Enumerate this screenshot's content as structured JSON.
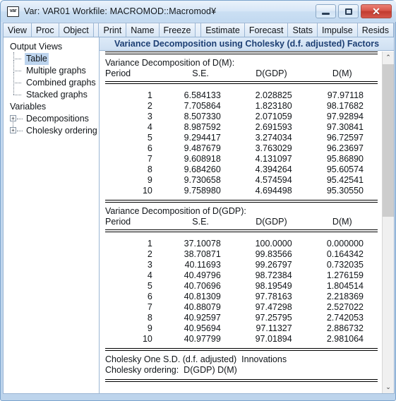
{
  "window": {
    "icon_label": "var",
    "title": "Var: VAR01   Workfile: MACROMOD::Macromod¥",
    "minimize_label": "—",
    "maximize_label": "□",
    "close_label": "✕"
  },
  "toolbar": {
    "buttons": [
      "View",
      "Proc",
      "Object",
      "Print",
      "Name",
      "Freeze",
      "Estimate",
      "Forecast",
      "Stats",
      "Impulse",
      "Resids"
    ]
  },
  "sidebar": {
    "groups": [
      {
        "title": "Output Views",
        "items": [
          {
            "label": "Table",
            "selected": true,
            "expandable": false
          },
          {
            "label": "Multiple graphs",
            "selected": false,
            "expandable": false
          },
          {
            "label": "Combined graphs",
            "selected": false,
            "expandable": false
          },
          {
            "label": "Stacked graphs",
            "selected": false,
            "expandable": false
          }
        ]
      },
      {
        "title": "Variables",
        "items": [
          {
            "label": "Decompositions",
            "selected": false,
            "expandable": true,
            "expand_glyph": "+"
          },
          {
            "label": "Cholesky ordering",
            "selected": false,
            "expandable": true,
            "expand_glyph": "+"
          }
        ]
      }
    ]
  },
  "main": {
    "header_title": "Variance Decomposition using Cholesky (d.f. adjusted) Factors",
    "tables": [
      {
        "caption": "Variance Decomposition of D(M):",
        "columns": [
          "Period",
          "S.E.",
          "D(GDP)",
          "D(M)"
        ],
        "rows": [
          [
            "1",
            "6.584133",
            "2.028825",
            "97.97118"
          ],
          [
            "2",
            "7.705864",
            "1.823180",
            "98.17682"
          ],
          [
            "3",
            "8.507330",
            "2.071059",
            "97.92894"
          ],
          [
            "4",
            "8.987592",
            "2.691593",
            "97.30841"
          ],
          [
            "5",
            "9.294417",
            "3.274034",
            "96.72597"
          ],
          [
            "6",
            "9.487679",
            "3.763029",
            "96.23697"
          ],
          [
            "7",
            "9.608918",
            "4.131097",
            "95.86890"
          ],
          [
            "8",
            "9.684260",
            "4.394264",
            "95.60574"
          ],
          [
            "9",
            "9.730658",
            "4.574594",
            "95.42541"
          ],
          [
            "10",
            "9.758980",
            "4.694498",
            "95.30550"
          ]
        ]
      },
      {
        "caption": "Variance Decomposition of D(GDP):",
        "columns": [
          "Period",
          "S.E.",
          "D(GDP)",
          "D(M)"
        ],
        "rows": [
          [
            "1",
            "37.10078",
            "100.0000",
            "0.000000"
          ],
          [
            "2",
            "38.70871",
            "99.83566",
            "0.164342"
          ],
          [
            "3",
            "40.11693",
            "99.26797",
            "0.732035"
          ],
          [
            "4",
            "40.49796",
            "98.72384",
            "1.276159"
          ],
          [
            "5",
            "40.70696",
            "98.19549",
            "1.804514"
          ],
          [
            "6",
            "40.81309",
            "97.78163",
            "2.218369"
          ],
          [
            "7",
            "40.88079",
            "97.47298",
            "2.527022"
          ],
          [
            "8",
            "40.92597",
            "97.25795",
            "2.742053"
          ],
          [
            "9",
            "40.95694",
            "97.11327",
            "2.886732"
          ],
          [
            "10",
            "40.97799",
            "97.01894",
            "2.981064"
          ]
        ]
      }
    ],
    "footnotes": [
      "Cholesky One S.D. (d.f. adjusted)  Innovations",
      "Cholesky ordering:  D(GDP) D(M)"
    ]
  },
  "scrollbar": {
    "up_glyph": "⌃",
    "down_glyph": "⌄"
  },
  "colors": {
    "accent": "#1d3f73",
    "selection": "#bdd4ee",
    "frame": "#9bb6d4",
    "close": "#c13c30"
  },
  "chart_data": {
    "type": "table",
    "title": "Variance Decomposition using Cholesky (d.f. adjusted) Factors",
    "tables": [
      {
        "name": "Variance Decomposition of D(M)",
        "columns": [
          "Period",
          "S.E.",
          "D(GDP)",
          "D(M)"
        ],
        "x": [
          1,
          2,
          3,
          4,
          5,
          6,
          7,
          8,
          9,
          10
        ],
        "series": [
          {
            "name": "S.E.",
            "values": [
              6.584133,
              7.705864,
              8.50733,
              8.987592,
              9.294417,
              9.487679,
              9.608918,
              9.68426,
              9.730658,
              9.75898
            ]
          },
          {
            "name": "D(GDP)",
            "values": [
              2.028825,
              1.82318,
              2.071059,
              2.691593,
              3.274034,
              3.763029,
              4.131097,
              4.394264,
              4.574594,
              4.694498
            ]
          },
          {
            "name": "D(M)",
            "values": [
              97.97118,
              98.17682,
              97.92894,
              97.30841,
              96.72597,
              96.23697,
              95.8689,
              95.60574,
              95.42541,
              95.3055
            ]
          }
        ]
      },
      {
        "name": "Variance Decomposition of D(GDP)",
        "columns": [
          "Period",
          "S.E.",
          "D(GDP)",
          "D(M)"
        ],
        "x": [
          1,
          2,
          3,
          4,
          5,
          6,
          7,
          8,
          9,
          10
        ],
        "series": [
          {
            "name": "S.E.",
            "values": [
              37.10078,
              38.70871,
              40.11693,
              40.49796,
              40.70696,
              40.81309,
              40.88079,
              40.92597,
              40.95694,
              40.97799
            ]
          },
          {
            "name": "D(GDP)",
            "values": [
              100.0,
              99.83566,
              99.26797,
              98.72384,
              98.19549,
              97.78163,
              97.47298,
              97.25795,
              97.11327,
              97.01894
            ]
          },
          {
            "name": "D(M)",
            "values": [
              0.0,
              0.164342,
              0.732035,
              1.276159,
              1.804514,
              2.218369,
              2.527022,
              2.742053,
              2.886732,
              2.981064
            ]
          }
        ]
      }
    ],
    "notes": [
      "Cholesky One S.D. (d.f. adjusted)  Innovations",
      "Cholesky ordering:  D(GDP) D(M)"
    ]
  }
}
